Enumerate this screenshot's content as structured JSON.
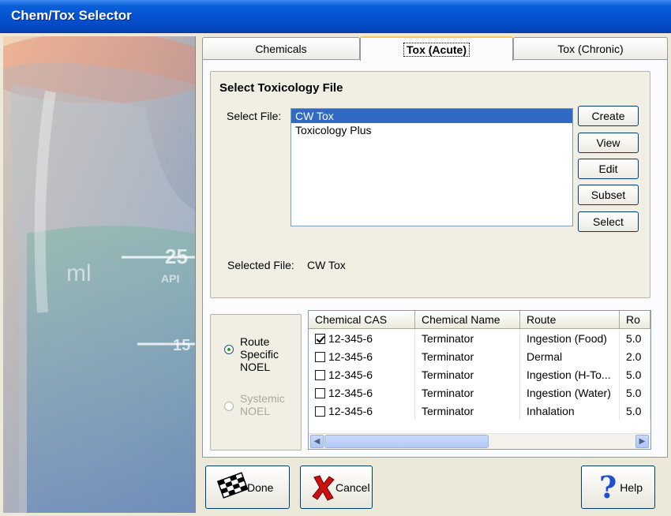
{
  "window": {
    "title": "Chem/Tox Selector"
  },
  "tabs": [
    {
      "label": "Chemicals"
    },
    {
      "label": "Tox (Acute)"
    },
    {
      "label": "Tox (Chronic)"
    }
  ],
  "file_group": {
    "title": "Select Toxicology File",
    "select_file_label": "Select File:",
    "files": [
      "CW Tox",
      "Toxicology Plus"
    ],
    "selected_index": 0,
    "selected_file_label": "Selected File:",
    "selected_file_value": "CW Tox"
  },
  "file_buttons": {
    "create": "Create",
    "view": "View",
    "edit": "Edit",
    "subset": "Subset",
    "select": "Select"
  },
  "noel": {
    "route_specific": "Route Specific NOEL",
    "route_specific_lines": [
      "Route",
      "Specific",
      "NOEL"
    ],
    "systemic_lines": [
      "Systemic",
      "NOEL"
    ],
    "selected": "route_specific"
  },
  "grid": {
    "columns": [
      "Chemical CAS",
      "Chemical Name",
      "Route",
      "Ro"
    ],
    "rows": [
      {
        "checked": true,
        "cas": "12-345-6",
        "name": "Terminator",
        "route": "Ingestion (Food)",
        "ro": "5.0"
      },
      {
        "checked": false,
        "cas": "12-345-6",
        "name": "Terminator",
        "route": "Dermal",
        "ro": "2.0"
      },
      {
        "checked": false,
        "cas": "12-345-6",
        "name": "Terminator",
        "route": "Ingestion (H-To...",
        "ro": "5.0"
      },
      {
        "checked": false,
        "cas": "12-345-6",
        "name": "Terminator",
        "route": "Ingestion (Water)",
        "ro": "5.0"
      },
      {
        "checked": false,
        "cas": "12-345-6",
        "name": "Terminator",
        "route": "Inhalation",
        "ro": "5.0"
      }
    ]
  },
  "bottom_buttons": {
    "done": "Done",
    "cancel": "Cancel",
    "help": "Help"
  },
  "side_image": {
    "printed_text": [
      "25",
      "API",
      "ml",
      "15"
    ]
  }
}
